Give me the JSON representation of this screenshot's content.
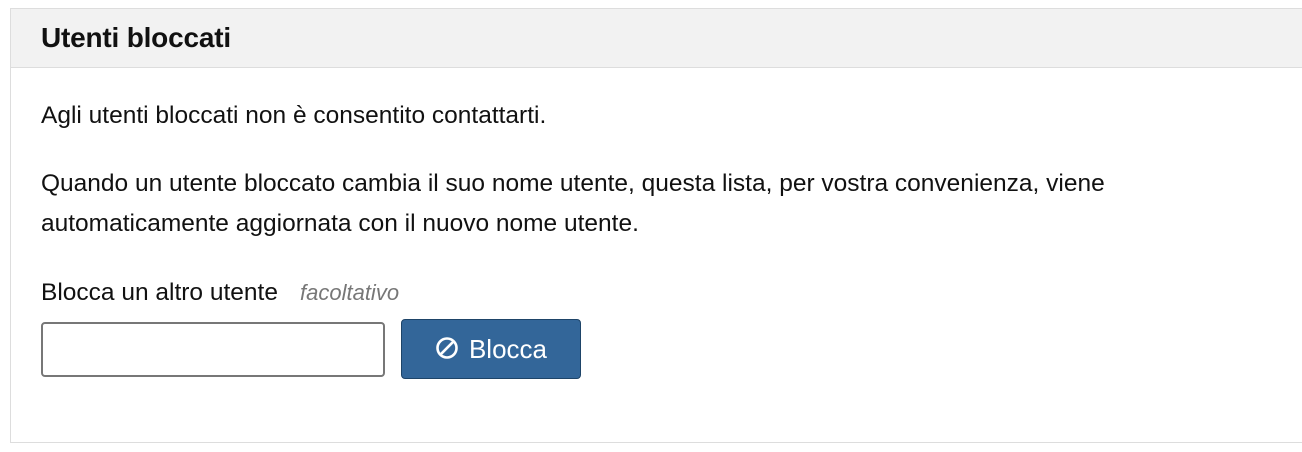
{
  "panel": {
    "title": "Utenti bloccati",
    "description_1": "Agli utenti bloccati non è consentito contattarti.",
    "description_2": "Quando un utente bloccato cambia il suo nome utente, questa lista, per vostra convenienza, viene automaticamente aggiornata con il nuovo nome utente."
  },
  "form": {
    "label": "Blocca un altro utente",
    "optional_label": "facoltativo",
    "input_value": "",
    "input_placeholder": "",
    "button_label": "Blocca",
    "button_icon": "ban-icon"
  },
  "colors": {
    "header_background": "#f2f2f2",
    "button_background": "#336699",
    "optional_text": "#777777"
  }
}
